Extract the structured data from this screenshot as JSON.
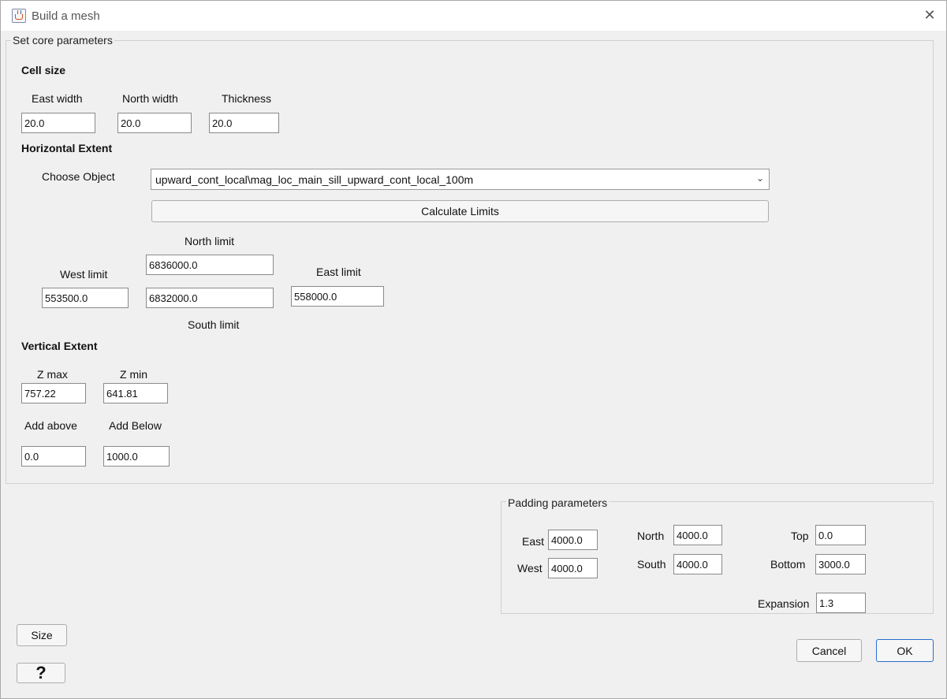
{
  "window": {
    "title": "Build a mesh"
  },
  "core": {
    "group_title": "Set core parameters",
    "cell_size": {
      "heading": "Cell size",
      "east_width_label": "East width",
      "north_width_label": "North width",
      "thickness_label": "Thickness",
      "east_width": "20.0",
      "north_width": "20.0",
      "thickness": "20.0"
    },
    "horizontal": {
      "heading": "Horizontal Extent",
      "choose_object_label": "Choose Object",
      "selected_object": "upward_cont_local\\mag_loc_main_sill_upward_cont_local_100m",
      "calculate_button": "Calculate Limits",
      "north_label": "North limit",
      "west_label": "West limit",
      "east_label": "East limit",
      "south_label": "South limit",
      "north": "6836000.0",
      "west": "553500.0",
      "south": "6832000.0",
      "east": "558000.0"
    },
    "vertical": {
      "heading": "Vertical Extent",
      "zmax_label": "Z max",
      "zmin_label": "Z min",
      "zmax": "757.22",
      "zmin": "641.81",
      "add_above_label": "Add above",
      "add_below_label": "Add Below",
      "add_above": "0.0",
      "add_below": "1000.0"
    }
  },
  "padding": {
    "group_title": "Padding parameters",
    "east_label": "East",
    "east": "4000.0",
    "west_label": "West",
    "west": "4000.0",
    "north_label": "North",
    "north": "4000.0",
    "south_label": "South",
    "south": "4000.0",
    "top_label": "Top",
    "top": "0.0",
    "bottom_label": "Bottom",
    "bottom": "3000.0",
    "expansion_label": "Expansion",
    "expansion": "1.3"
  },
  "buttons": {
    "size": "Size",
    "help": "?",
    "cancel": "Cancel",
    "ok": "OK"
  },
  "icons": {
    "app": "java-app-icon",
    "close": "close-icon"
  }
}
